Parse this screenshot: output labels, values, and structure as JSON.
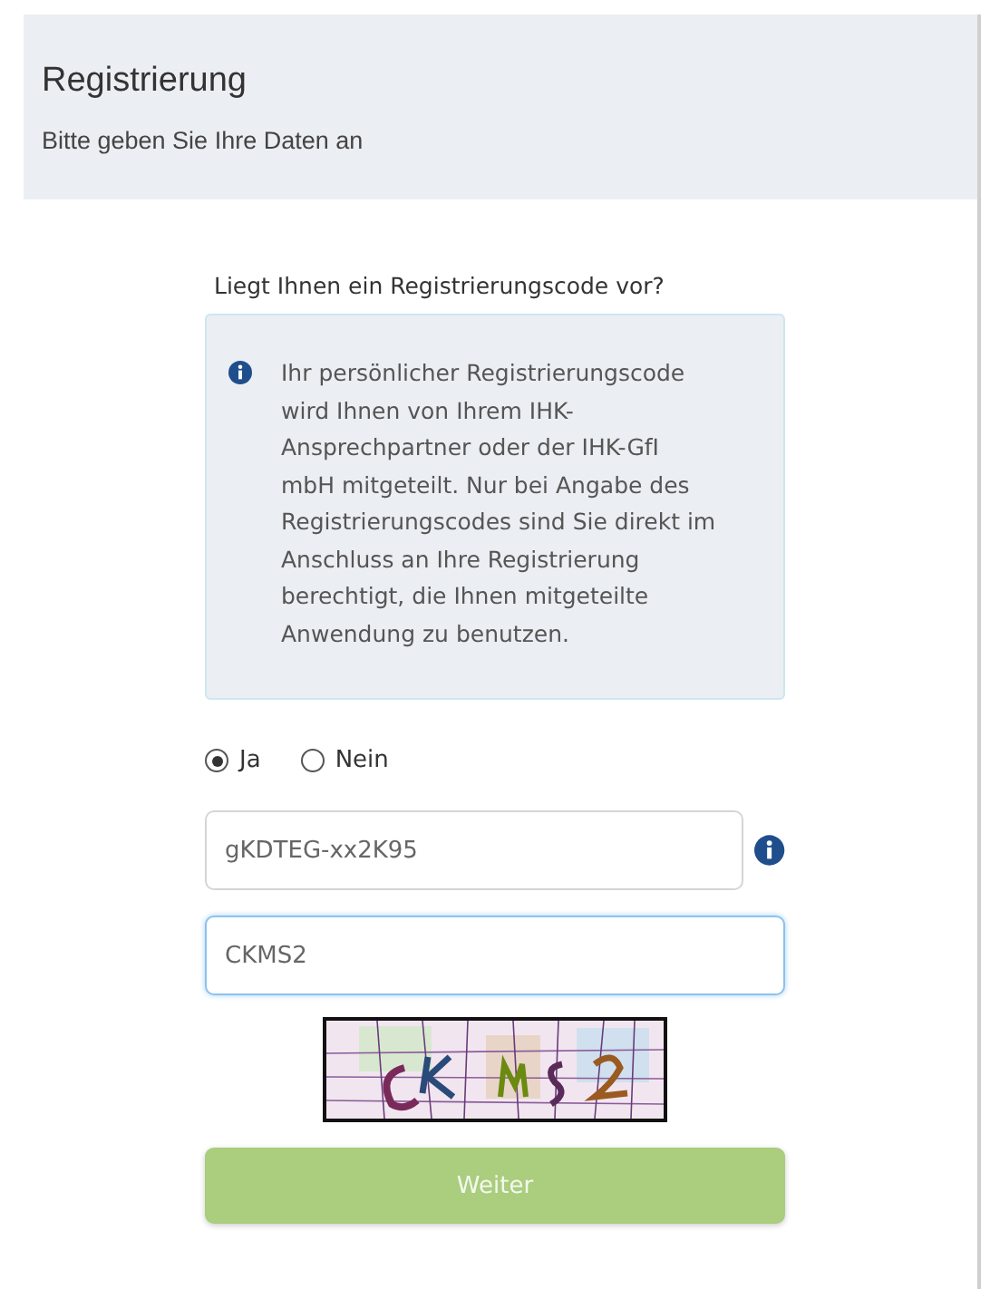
{
  "header": {
    "title": "Registrierung",
    "subtitle": "Bitte geben Sie Ihre Daten an"
  },
  "question": "Liegt Ihnen ein Registrierungscode vor?",
  "info_box": {
    "text": "Ihr persönlicher Registrierungscode wird Ihnen von Ihrem IHK-Ansprechpartner oder der IHK-GfI mbH mitgeteilt. Nur bei Angabe des Registrierungscodes sind Sie direkt im Anschluss an Ihre Registrierung berechtigt, die Ihnen mitgeteilte Anwendung zu benutzen."
  },
  "options": [
    {
      "label": "Ja",
      "selected": true
    },
    {
      "label": "Nein",
      "selected": false
    }
  ],
  "fields": [
    {
      "value": "gKDTEG-xx2K95",
      "focused": false,
      "info": true
    },
    {
      "value": "CKMS2",
      "focused": true,
      "info": false
    }
  ],
  "button": {
    "label": "Weiter",
    "disabled": true
  }
}
